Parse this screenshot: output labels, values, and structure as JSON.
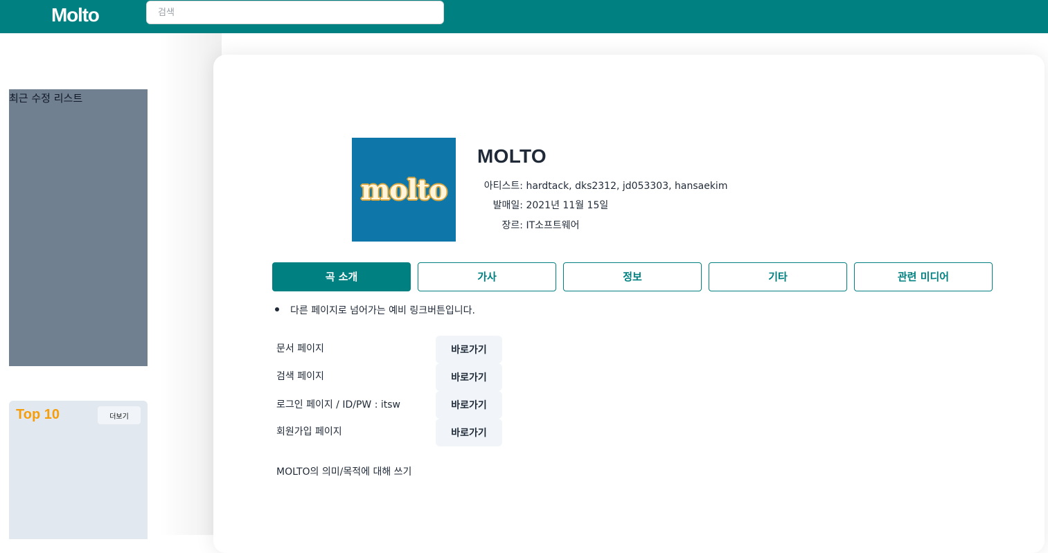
{
  "header": {
    "logo": "Molto",
    "search_placeholder": "검색"
  },
  "sidebar": {
    "recent_title": "최근 수정 리스트",
    "top10": {
      "title": "Top 10",
      "more_label": "더보기"
    }
  },
  "song": {
    "album_art_text": "molto",
    "title": "MOLTO",
    "meta": [
      {
        "key": "아티스트:",
        "value": "hardtack, dks2312, jd053303, hansaekim"
      },
      {
        "key": "발매일:",
        "value": "2021년 11월 15일"
      },
      {
        "key": "장르:",
        "value": "IT소프트웨어"
      }
    ]
  },
  "tabs": [
    {
      "label": "곡 소개",
      "active": true
    },
    {
      "label": "가사",
      "active": false
    },
    {
      "label": "정보",
      "active": false
    },
    {
      "label": "기타",
      "active": false
    },
    {
      "label": "관련 미디어",
      "active": false
    }
  ],
  "content": {
    "notice": "다른 페이지로 넘어가는 예비 링크버튼입니다.",
    "links": [
      {
        "label": "문서 페이지",
        "button": "바로가기"
      },
      {
        "label": "검색 페이지",
        "button": "바로가기"
      },
      {
        "label": "로그인 페이지 / ID/PW : itsw",
        "button": "바로가기"
      },
      {
        "label": "회원가입 페이지",
        "button": "바로가기"
      }
    ],
    "description": "MOLTO의 의미/목적에 대해 쓰기"
  },
  "colors": {
    "brand": "#008080",
    "sidebar_recent_bg": "#708090",
    "top10_accent": "#f59e0b"
  }
}
